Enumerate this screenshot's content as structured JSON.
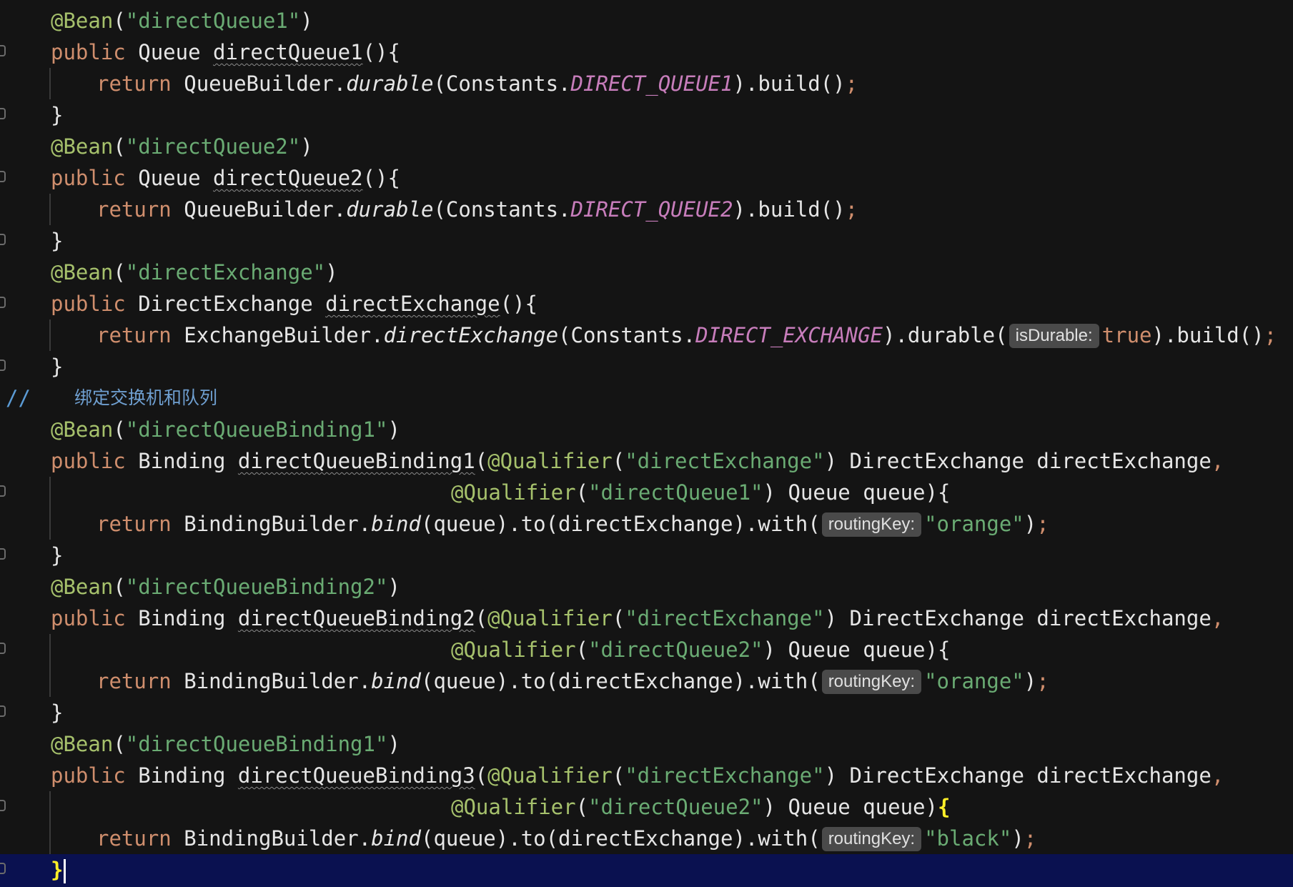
{
  "editor": {
    "theme": {
      "background": "#141414",
      "current_line": "#0a1150",
      "annotation": "#a6c16c",
      "string": "#6aab73",
      "keyword": "#cf8e6d",
      "constant": "#c77dbb",
      "comment": "#5b9bd5",
      "hint_background": "#4a4a4a",
      "brace_highlight": "#ffef28"
    },
    "tokens": {
      "bean_ann": "@Bean",
      "qualifier_ann": "@Qualifier",
      "kw_public": "public",
      "kw_return": "return",
      "kw_true": "true",
      "type_queue": "Queue",
      "type_direct_exchange": "DirectExchange",
      "type_binding": "Binding",
      "lparen": "(",
      "rparen": ")",
      "paren_brace": "){",
      "open_paren_brace": "(){",
      "close_brace": "}",
      "semicolon": ";",
      "comma": ",",
      "queue_builder": "QueueBuilder.",
      "exchange_builder": "ExchangeBuilder.",
      "binding_builder": "BindingBuilder.",
      "durable_method": "durable",
      "direct_exchange_method": "directExchange",
      "bind_method": "bind",
      "constants_prefix": "(Constants.",
      "build_call": ").build()",
      "durable_call_open": ").durable(",
      "build_call_after_true": ").build()",
      "queue_to_exchange": "(queue).to(directExchange).with(",
      "close_call": ")",
      "param_direct_exchange": " DirectExchange directExchange",
      "param_queue": " Queue queue",
      "space": " "
    },
    "lines": {
      "l1_bean_name": "\"directQueue1\"",
      "l2_method": "directQueue1",
      "l3_const": "DIRECT_QUEUE1",
      "l5_bean_name": "\"directQueue2\"",
      "l6_method": "directQueue2",
      "l7_const": "DIRECT_QUEUE2",
      "l9_bean_name": "\"directExchange\"",
      "l10_method": "directExchange",
      "l11_const": "DIRECT_EXCHANGE",
      "l11_hint": "isDurable:",
      "l13_comment_slashes": "//",
      "l13_comment_text": "绑定交换机和队列",
      "l14_bean_name": "\"directQueueBinding1\"",
      "l15_method": "directQueueBinding1",
      "qualifier_exchange": "\"directExchange\"",
      "l16_qualifier": "\"directQueue1\"",
      "l17_hint": "routingKey:",
      "l17_value": "\"orange\"",
      "l19_bean_name": "\"directQueueBinding2\"",
      "l20_method": "directQueueBinding2",
      "l21_qualifier": "\"directQueue2\"",
      "l22_hint": "routingKey:",
      "l22_value": "\"orange\"",
      "l24_bean_name": "\"directQueueBinding1\"",
      "l25_method": "directQueueBinding3",
      "l26_qualifier": "\"directQueue2\"",
      "l27_hint": "routingKey:",
      "l27_value": "\"black\""
    }
  }
}
